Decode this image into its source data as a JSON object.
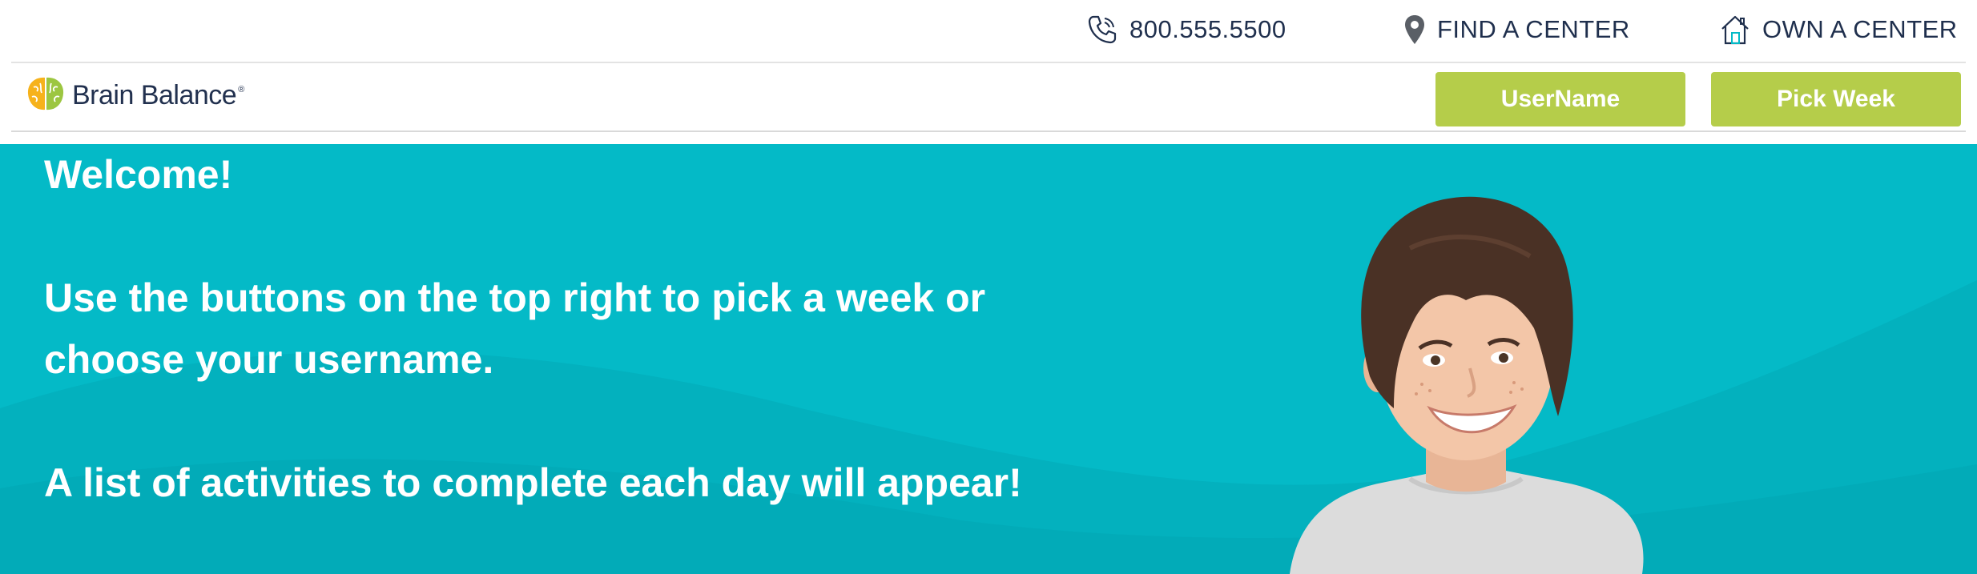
{
  "topbar": {
    "phone": "800.555.5500",
    "find_center": "FIND A CENTER",
    "own_center": "OWN A CENTER",
    "icons": {
      "phone": "phone-icon",
      "location": "map-pin-icon",
      "home": "house-icon"
    }
  },
  "brand": {
    "name": "Brain Balance",
    "reg_mark": "®",
    "logo_icon": "brain-logo-icon"
  },
  "nav": {
    "username_label": "UserName",
    "pick_week_label": "Pick Week"
  },
  "hero": {
    "welcome": "Welcome!",
    "instructions": "Use the buttons on the top right to pick a week or choose your username.",
    "activities": "A list of activities to complete each day will appear!",
    "image": "smiling-child-photo"
  },
  "colors": {
    "accent_green": "#b5cd4a",
    "hero_teal": "#04bac7",
    "navy_text": "#1f2f4d"
  }
}
